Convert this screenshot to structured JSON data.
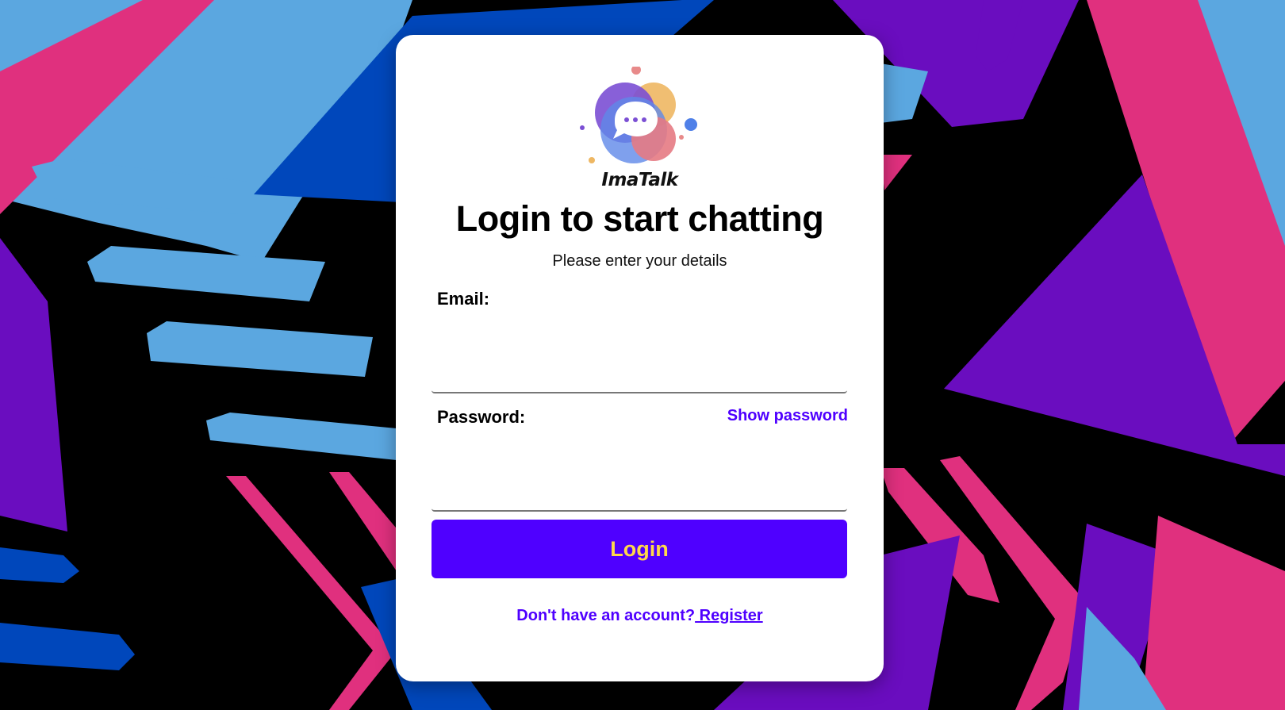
{
  "app": {
    "brand": "ImaTalk"
  },
  "login": {
    "title": "Login to start chatting",
    "subtitle": "Please enter your details",
    "email_label": "Email:",
    "email_value": "",
    "password_label": "Password:",
    "password_value": "",
    "show_password": "Show password",
    "submit_label": "Login",
    "register_prompt": "Don't have an account?",
    "register_link": " Register"
  },
  "colors": {
    "accent": "#4f00ff",
    "button_text": "#ffd84a",
    "card_bg": "#ffffff",
    "background": "#000000",
    "bg_pink": "#e0307e",
    "bg_light_blue": "#5ba7e0",
    "bg_blue": "#0047bb",
    "bg_purple": "#6a0dbf"
  },
  "icons": {
    "logo": "chat-bubble-logo-icon"
  }
}
